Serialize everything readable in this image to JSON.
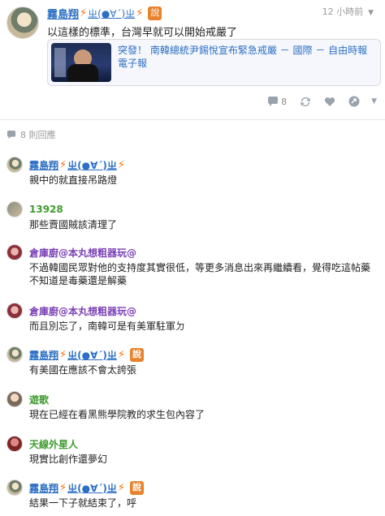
{
  "post": {
    "author": "霧島翔",
    "bolt": "⚡",
    "kaomoji": "ㄓ(●∀´)ㄓ",
    "badge": "說",
    "time": "12 小時前",
    "text": "以這樣的標準，台灣早就可以開始戒嚴了",
    "link_title": "突發！ 南韓總統尹錫悅宣布緊急戒嚴 － 國際 － 自由時報電子報",
    "actions": {
      "comment_count": "8"
    }
  },
  "comments_header": "8 則回應",
  "comments": [
    {
      "author": "霧島翔",
      "kaomoji": "ㄓ(●∀´)ㄓ",
      "badge": "說",
      "text": "親中的就直接吊路燈"
    },
    {
      "author": "13928",
      "text": "那些賣國賊該清理了"
    },
    {
      "author": "倉庫廚@本丸想粗器玩@",
      "text": "不過韓國民眾對他的支持度其實很低，等更多消息出來再繼續看，覺得吃這帖藥不知道是毒藥還是解藥"
    },
    {
      "author": "倉庫廚@本丸想粗器玩@",
      "text": "而且別忘了，南韓可是有美軍駐軍ㄉ"
    },
    {
      "author": "霧島翔",
      "kaomoji": "ㄓ(●∀´)ㄓ",
      "badge": "說",
      "text": "有美國在應該不會太誇張"
    },
    {
      "author": "遊歌",
      "text": "現在已經在看黑熊學院教的求生包內容了"
    },
    {
      "author": "天線外星人",
      "text": "現實比創作還夢幻"
    },
    {
      "author": "霧島翔",
      "kaomoji": "ㄓ(●∀´)ㄓ",
      "badge": "說",
      "text": "結果一下子就結束了，呼"
    }
  ],
  "colors": {
    "link_blue": "#2c6fc4",
    "bolt_orange": "#ff6a00",
    "badge_orange": "#e8822c",
    "name_green": "#3f9b2f",
    "name_purple": "#7a3fb5",
    "icon_gray": "#9aa3ad"
  },
  "icons": [
    "comment-icon",
    "repost-icon",
    "heart-icon",
    "share-icon",
    "chevron-down-icon"
  ]
}
